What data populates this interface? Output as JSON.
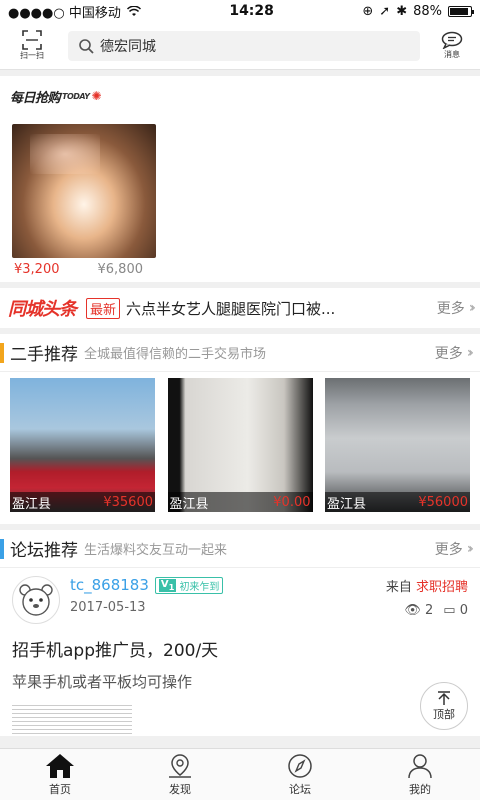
{
  "status": {
    "carrier": "●●●●○ 中国移动",
    "time": "14:28",
    "battery": "88%",
    "battery_level": 0.88
  },
  "topbar": {
    "scan_label": "扫一扫",
    "search_value": "德宏同城",
    "msg_label": "消息"
  },
  "daily": {
    "logo": "每日抢购",
    "logo_sub": "TODAY",
    "price_now": "¥3,200",
    "price_old": "¥6,800"
  },
  "headline": {
    "logo": "同城头条",
    "tag": "最新",
    "text": "六点半女艺人腿腿医院门口被...",
    "more": "更多"
  },
  "secondhand": {
    "title": "二手推荐",
    "subtitle": "全城最值得信赖的二手交易市场",
    "more": "更多",
    "items": [
      {
        "location": "盈江县",
        "price": "¥35600"
      },
      {
        "location": "盈江县",
        "price": "¥0.00"
      },
      {
        "location": "盈江县",
        "price": "¥56000"
      }
    ]
  },
  "forum": {
    "title": "论坛推荐",
    "subtitle": "生活爆料交友互动一起来",
    "more": "更多",
    "post": {
      "username": "tc_868183",
      "badge_v": "V",
      "badge_level": "1",
      "badge_text": "初来乍到",
      "date": "2017-05-13",
      "from_label": "来自",
      "category": "求职招聘",
      "views": "2",
      "comments": "0",
      "title": "招手机app推广员，200/天",
      "desc": "苹果手机或者平板均可操作"
    },
    "to_top": "顶部"
  },
  "tabs": [
    {
      "label": "首页",
      "active": true
    },
    {
      "label": "发现",
      "active": false
    },
    {
      "label": "论坛",
      "active": false
    },
    {
      "label": "我的",
      "active": false
    }
  ]
}
